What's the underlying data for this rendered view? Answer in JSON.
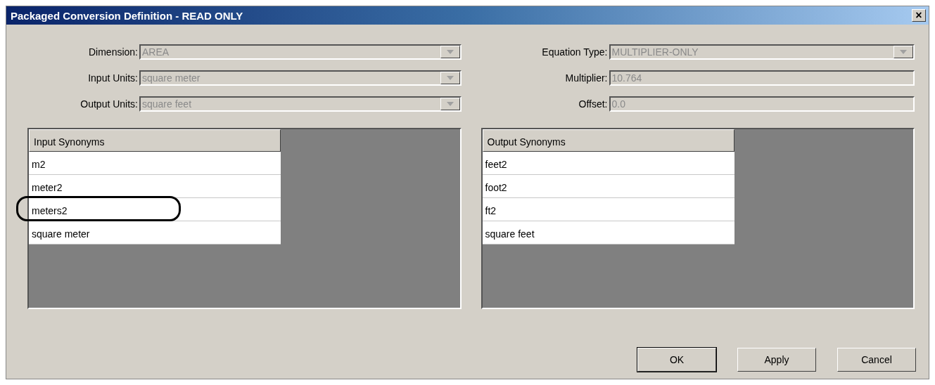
{
  "window": {
    "title": "Packaged Conversion Definition - READ ONLY",
    "close": "×"
  },
  "left_fields": [
    {
      "label": "Dimension:",
      "value": "AREA",
      "kind": "dropdown",
      "disabled": true
    },
    {
      "label": "Input Units:",
      "value": "square meter",
      "kind": "dropdown",
      "disabled": true
    },
    {
      "label": "Output Units:",
      "value": "square feet",
      "kind": "dropdown",
      "disabled": true
    }
  ],
  "right_fields": [
    {
      "label": "Equation Type:",
      "value": "MULTIPLIER-ONLY",
      "kind": "dropdown",
      "disabled": true
    },
    {
      "label": "Multiplier:",
      "value": "10.764",
      "kind": "text",
      "disabled": true
    },
    {
      "label": "Offset:",
      "value": "0.0",
      "kind": "text",
      "disabled": true
    }
  ],
  "tables": [
    {
      "column": "Input Synonyms",
      "rows": [
        {
          "text": "m2",
          "circled": false
        },
        {
          "text": "meter2",
          "circled": false
        },
        {
          "text": "meters2",
          "circled": true
        },
        {
          "text": "square meter",
          "circled": false
        }
      ]
    },
    {
      "column": "Output Synonyms",
      "rows": [
        {
          "text": "feet2",
          "circled": false
        },
        {
          "text": "foot2",
          "circled": false
        },
        {
          "text": "ft2",
          "circled": false
        },
        {
          "text": "square feet",
          "circled": false
        }
      ]
    }
  ],
  "buttons": [
    {
      "label": "OK",
      "default": true
    },
    {
      "label": "Apply",
      "default": false
    },
    {
      "label": "Cancel",
      "default": false
    }
  ]
}
